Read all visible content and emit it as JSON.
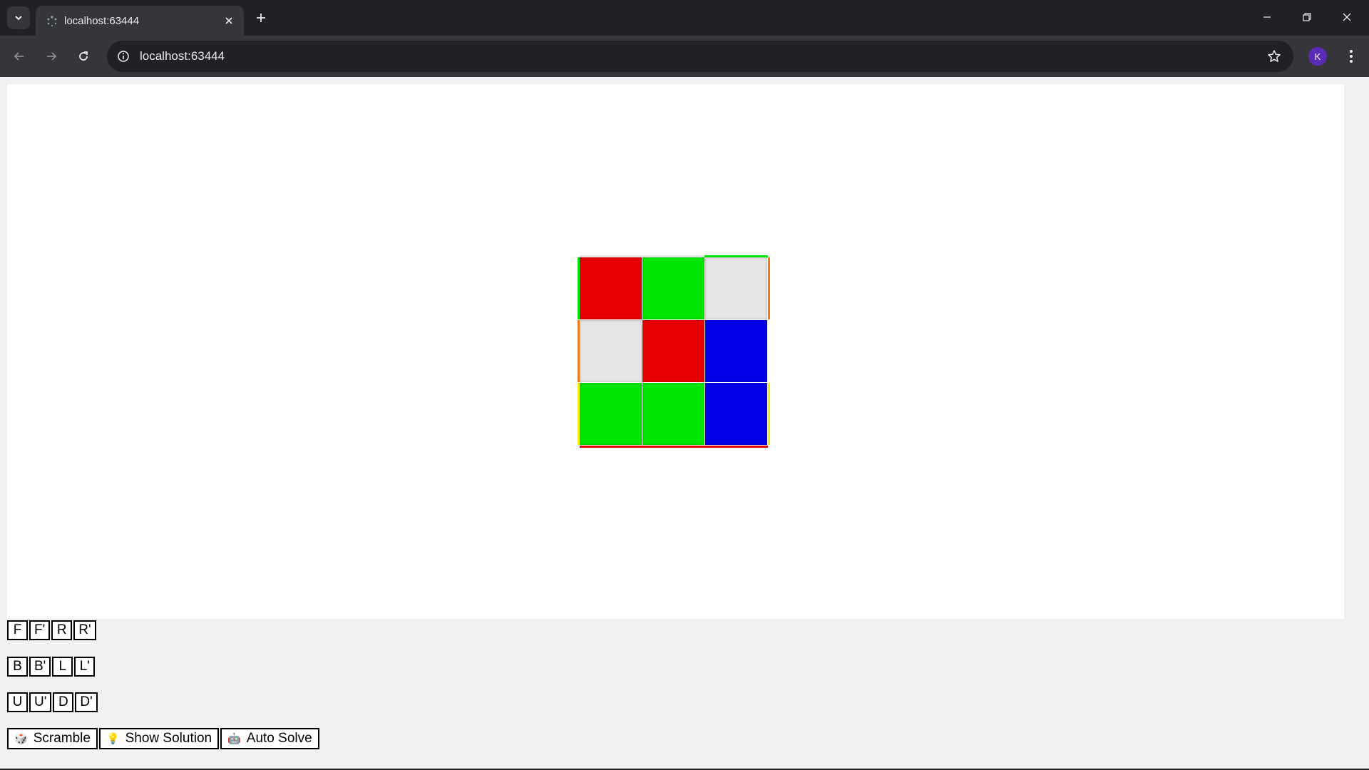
{
  "browser": {
    "tab_title": "localhost:63444",
    "url": "localhost:63444",
    "avatar_letter": "K"
  },
  "cube": {
    "front_face": [
      [
        "red",
        "green",
        "white"
      ],
      [
        "white",
        "red",
        "blue"
      ],
      [
        "green",
        "green",
        "blue"
      ]
    ],
    "colors": {
      "red": "#e60000",
      "green": "#00e600",
      "blue": "#0000e6",
      "white": "#e6e6e6",
      "orange": "#f07a1a",
      "yellow": "#f0f000"
    }
  },
  "controls": {
    "row1": [
      "F",
      "F'",
      "R",
      "R'"
    ],
    "row2": [
      "B",
      "B'",
      "L",
      "L'"
    ],
    "row3": [
      "U",
      "U'",
      "D",
      "D'"
    ],
    "scramble_label": "Scramble",
    "show_solution_label": "Show Solution",
    "auto_solve_label": "Auto Solve",
    "scramble_icon": "🎲",
    "solution_icon": "💡",
    "auto_solve_icon": "🤖"
  }
}
